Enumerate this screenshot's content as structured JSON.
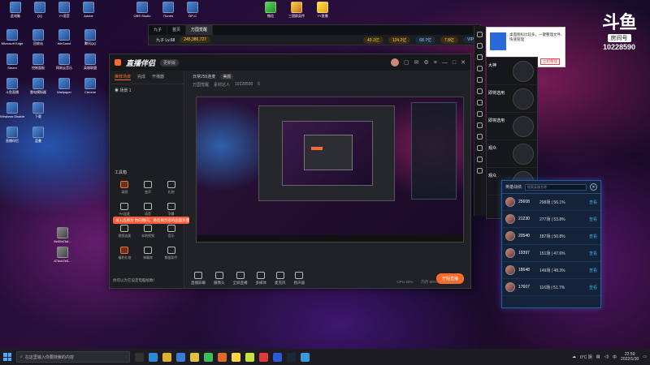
{
  "desktop": {
    "icons_top": [
      {
        "label": "此电脑"
      },
      {
        "label": "QQ"
      },
      {
        "label": "YY语音"
      },
      {
        "label": "Adobe"
      },
      {
        "label": "OBS Studio"
      },
      {
        "label": "iTunes"
      },
      {
        "label": "OP-C"
      }
    ],
    "icons_top_right": [
      {
        "label": "微信"
      },
      {
        "label": "三国群英传"
      },
      {
        "label": "YY直播"
      }
    ],
    "icons_left": [
      {
        "label": "Microsoft Edge"
      },
      {
        "label": "回收站"
      },
      {
        "label": "WeGame"
      },
      {
        "label": "腾讯QQ"
      },
      {
        "label": "Steam"
      },
      {
        "label": "控制面板"
      },
      {
        "label": "网易云音乐"
      },
      {
        "label": "英雄联盟"
      },
      {
        "label": "斗鱼直播"
      },
      {
        "label": "雷电模拟器"
      },
      {
        "label": "Wallpaper"
      },
      {
        "label": "Chrome"
      },
      {
        "label": "Windows Disabled"
      },
      {
        "label": "下载"
      },
      {
        "label": "直播伴侣"
      },
      {
        "label": "蓝叠"
      },
      {
        "label": "8ef2fa7bd..."
      },
      {
        "label": "87dcb7e5..."
      }
    ]
  },
  "douyu": {
    "logo": "斗鱼",
    "sub": "房间号",
    "room": "10228590"
  },
  "emulator": {
    "tabs": [
      "九子",
      "首页",
      "万国觉醒"
    ],
    "counter": "245,386,727",
    "player": "九子 Lv.68",
    "resources": [
      "43.1亿",
      "124.2亿",
      "68.7亿",
      "7.8亿"
    ],
    "vip": "VIP"
  },
  "notice": {
    "text": "桌面图标比较多，一键整理文件、快速管理",
    "button": "立即整理"
  },
  "main_window": {
    "app_name": "直播伴侣",
    "version": "更新版",
    "left_tabs": [
      "推荐场景",
      "完成",
      "开播器"
    ],
    "scene_label": "场景 1",
    "tools_title": "工具箱",
    "tools": [
      {
        "label": "录屏"
      },
      {
        "label": "变声"
      },
      {
        "label": "礼物"
      },
      {
        "label": "PK连麦"
      },
      {
        "label": "语音"
      },
      {
        "label": "字幕"
      },
      {
        "label": "视频连麦"
      },
      {
        "label": "本地视频"
      },
      {
        "label": "音乐"
      },
      {
        "label": "福利礼物"
      },
      {
        "label": "弹幕库"
      },
      {
        "label": "数据助手"
      }
    ],
    "toast": "录入选择为 你的期间，请选择合适的画面质量 ✕",
    "bottom_note": "你可以为它设定电脑帧数！",
    "center_title": "日常255连麦",
    "center_pill": "美颜",
    "center_sub": [
      "万国觉醒",
      "素材达人",
      "10228590",
      "6"
    ],
    "actions": [
      "直播屏幕",
      "摄像头",
      "全屏直播",
      "多媒体",
      "麦克风",
      "扬声器"
    ],
    "start_label": "开始直播",
    "status": [
      "CPU 40%",
      "内存 60%",
      "00:00:00"
    ]
  },
  "chat": {
    "items": [
      {
        "name": "大神"
      },
      {
        "name": "即将选用"
      },
      {
        "name": "即将选用"
      },
      {
        "name": "观众"
      },
      {
        "name": "观众"
      }
    ]
  },
  "rank": {
    "title": "英雄战绩",
    "search_placeholder": "搜索英雄名称",
    "close": "✕",
    "rows": [
      {
        "score": "25608",
        "stat": "298场 | 56.1%",
        "action": "查看"
      },
      {
        "score": "21230",
        "stat": "277场 | 53.8%",
        "action": "查看"
      },
      {
        "score": "20540",
        "stat": "187场 | 50.8%",
        "action": "查看"
      },
      {
        "score": "19397",
        "stat": "151场 | 47.6%",
        "action": "查看"
      },
      {
        "score": "18648",
        "stat": "149场 | 48.3%",
        "action": "查看"
      },
      {
        "score": "17607",
        "stat": "116场 | 51.7%",
        "action": "查看"
      }
    ]
  },
  "taskbar": {
    "search_placeholder": "在这里输入你要搜索的内容",
    "weather": "0°C 阴",
    "ime": "中",
    "time": "22:59",
    "date": "2022/1/30"
  },
  "colors": {
    "accent": "#ff6a2a",
    "blue": "#2a6ad8"
  }
}
